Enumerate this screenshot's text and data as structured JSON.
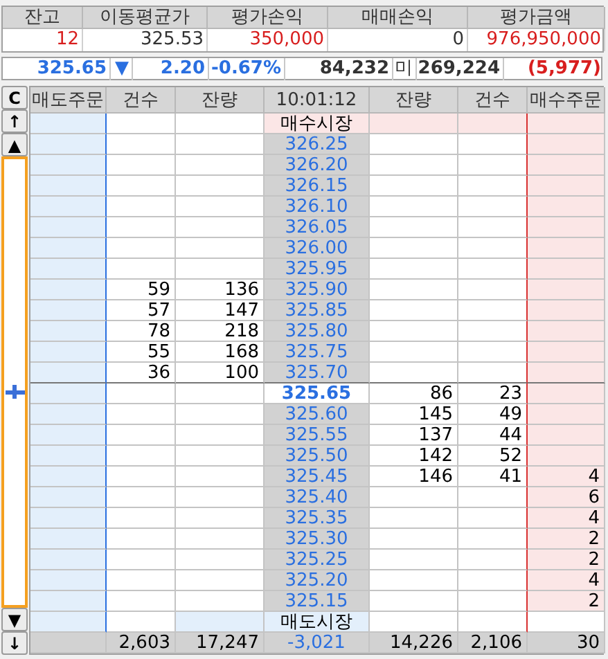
{
  "summary": {
    "columns": [
      "잔고",
      "이동평균가",
      "평가손익",
      "매매손익",
      "평가금액"
    ],
    "values": [
      {
        "text": "12",
        "kind": "gain"
      },
      {
        "text": "325.53",
        "kind": "flat"
      },
      {
        "text": "350,000",
        "kind": "gain"
      },
      {
        "text": "0",
        "kind": "flat"
      },
      {
        "text": "976,950,000",
        "kind": "gain"
      }
    ]
  },
  "quote": {
    "price": "325.65",
    "direction": "▼",
    "change": "2.20",
    "rate": "-0.67%",
    "volume": "84,232",
    "label": "미",
    "open_interest": "269,224",
    "oi_change": "(5,977)"
  },
  "side_buttons": {
    "top": [
      "C",
      "↑",
      "▲"
    ],
    "bottom": [
      "▼",
      "↓"
    ]
  },
  "order_book": {
    "columns": [
      "매도주문",
      "건수",
      "잔량",
      "10:01:12",
      "잔량",
      "건수",
      "매수주문"
    ],
    "rows": [
      {
        "kind": "buy_market",
        "price": "매수시장"
      },
      {
        "kind": "ask",
        "price": "326.25"
      },
      {
        "kind": "ask",
        "price": "326.20"
      },
      {
        "kind": "ask",
        "price": "326.15"
      },
      {
        "kind": "ask",
        "price": "326.10"
      },
      {
        "kind": "ask",
        "price": "326.05"
      },
      {
        "kind": "ask",
        "price": "326.00"
      },
      {
        "kind": "ask",
        "price": "325.95"
      },
      {
        "kind": "ask",
        "price": "325.90",
        "sell_count": "59",
        "sell_qty": "136"
      },
      {
        "kind": "ask",
        "price": "325.85",
        "sell_count": "57",
        "sell_qty": "147"
      },
      {
        "kind": "ask",
        "price": "325.80",
        "sell_count": "78",
        "sell_qty": "218"
      },
      {
        "kind": "ask",
        "price": "325.75",
        "sell_count": "55",
        "sell_qty": "168"
      },
      {
        "kind": "ask",
        "price": "325.70",
        "sell_count": "36",
        "sell_qty": "100"
      },
      {
        "kind": "current",
        "price": "325.65",
        "buy_qty": "86",
        "buy_count": "23"
      },
      {
        "kind": "bid",
        "price": "325.60",
        "buy_qty": "145",
        "buy_count": "49"
      },
      {
        "kind": "bid",
        "price": "325.55",
        "buy_qty": "137",
        "buy_count": "44"
      },
      {
        "kind": "bid",
        "price": "325.50",
        "buy_qty": "142",
        "buy_count": "52"
      },
      {
        "kind": "bid",
        "price": "325.45",
        "buy_qty": "146",
        "buy_count": "41",
        "buy_order": "4"
      },
      {
        "kind": "bid",
        "price": "325.40",
        "buy_order": "6"
      },
      {
        "kind": "bid",
        "price": "325.35",
        "buy_order": "4"
      },
      {
        "kind": "bid",
        "price": "325.30",
        "buy_order": "2"
      },
      {
        "kind": "bid",
        "price": "325.25",
        "buy_order": "2"
      },
      {
        "kind": "bid",
        "price": "325.20",
        "buy_order": "4"
      },
      {
        "kind": "bid",
        "price": "325.15",
        "buy_order": "2"
      },
      {
        "kind": "sell_market",
        "price": "매도시장"
      },
      {
        "kind": "total",
        "sell_count": "2,603",
        "sell_qty": "17,247",
        "price": "-3,021",
        "buy_qty": "14,226",
        "buy_count": "2,106",
        "buy_order": "30"
      }
    ]
  }
}
